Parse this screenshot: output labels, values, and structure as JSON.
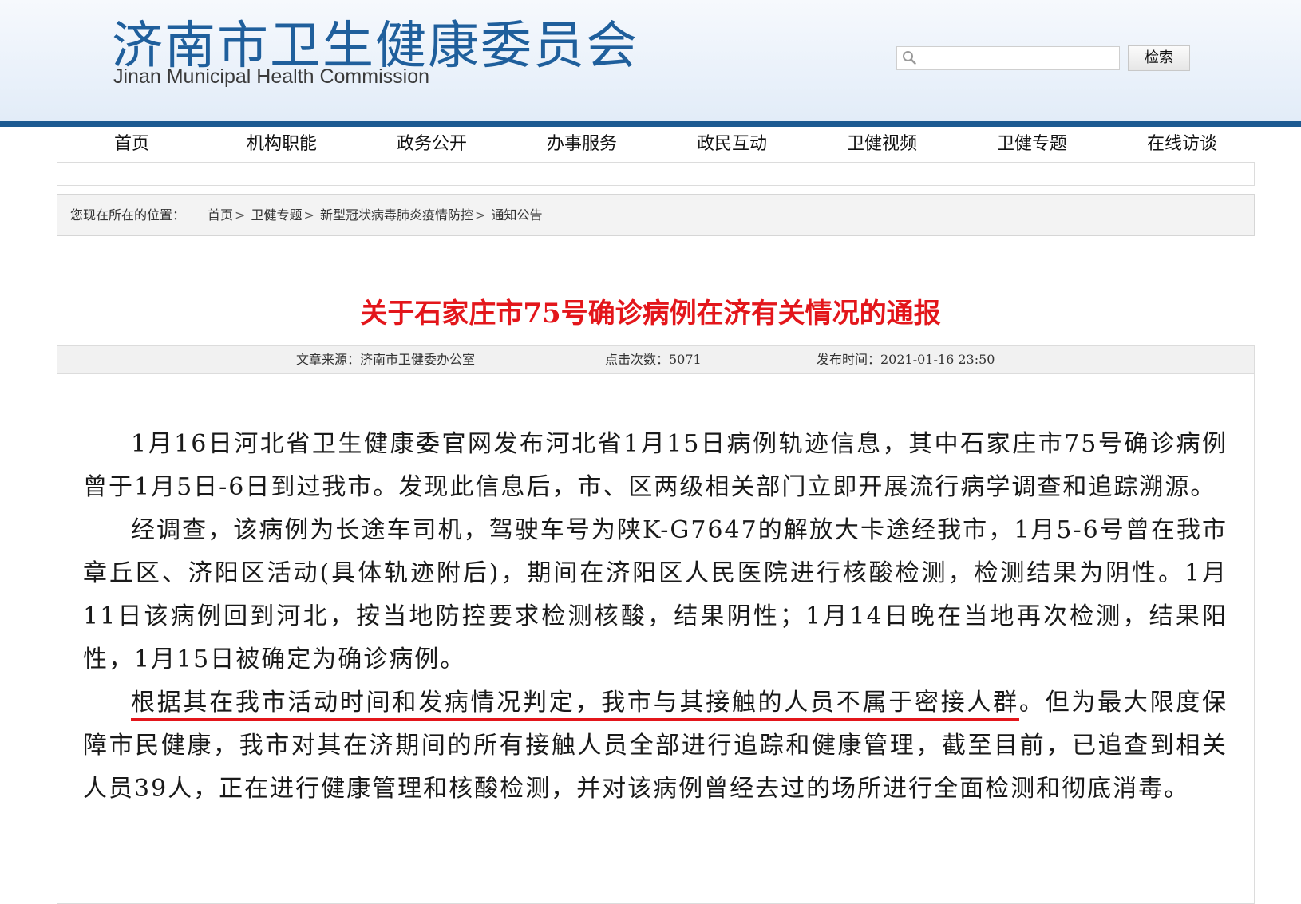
{
  "header": {
    "logo_cn": "济南市卫生健康委员会",
    "logo_en": "Jinan Municipal Health Commission",
    "search": {
      "placeholder": "",
      "button_label": "检索"
    }
  },
  "nav": {
    "items": [
      {
        "label": "首页"
      },
      {
        "label": "机构职能"
      },
      {
        "label": "政务公开"
      },
      {
        "label": "办事服务"
      },
      {
        "label": "政民互动"
      },
      {
        "label": "卫健视频"
      },
      {
        "label": "卫健专题"
      },
      {
        "label": "在线访谈"
      }
    ]
  },
  "breadcrumb": {
    "label": "您现在所在的位置：",
    "items": [
      "首页",
      "卫健专题",
      "新型冠状病毒肺炎疫情防控",
      "通知公告"
    ],
    "separator": ">"
  },
  "article": {
    "title": "关于石家庄市75号确诊病例在济有关情况的通报",
    "meta": {
      "source": "文章来源：济南市卫健委办公室",
      "views": "点击次数：5071",
      "published": "发布时间：2021-01-16 23:50"
    },
    "paragraphs": [
      "1月16日河北省卫生健康委官网发布河北省1月15日病例轨迹信息，其中石家庄市75号确诊病例曾于1月5日-6日到过我市。发现此信息后，市、区两级相关部门立即开展流行病学调查和追踪溯源。",
      "经调查，该病例为长途车司机，驾驶车号为陕K-G7647的解放大卡途经我市，1月5-6号曾在我市章丘区、济阳区活动(具体轨迹附后)，期间在济阳区人民医院进行核酸检测，检测结果为阴性。1月11日该病例回到河北，按当地防控要求检测核酸，结果阴性；1月14日晚在当地再次检测，结果阳性，1月15日被确定为确诊病例。"
    ],
    "p3_highlight": "根据其在我市活动时间和发病情况判定，我市与其接触的人员不属于密接人群",
    "p3_rest": "。但为最大限度保障市民健康，我市对其在济期间的所有接触人员全部进行追踪和健康管理，截至目前，已追查到相关人员39人，正在进行健康管理和核酸检测，并对该病例曾经去过的场所进行全面检测和彻底消毒。"
  },
  "colors": {
    "brand_blue": "#1c5a92",
    "title_red": "#e3161b",
    "logo_blue": "#1f5f9c"
  }
}
